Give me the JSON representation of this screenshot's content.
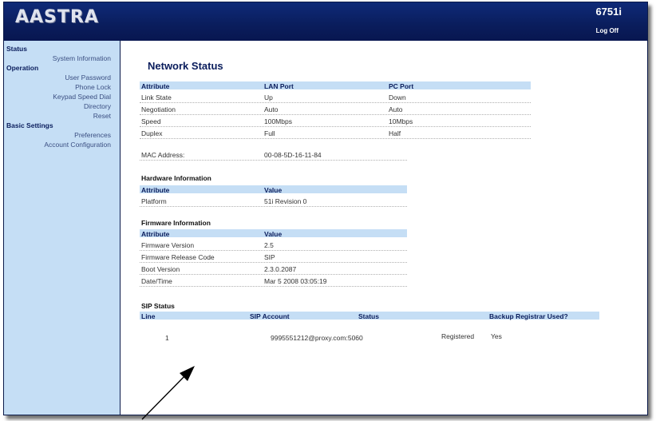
{
  "header": {
    "logo": "AASTRA",
    "model": "6751i",
    "logoff_label": "Log Off"
  },
  "sidebar": {
    "status_heading": "Status",
    "system_information": "System Information",
    "operation_heading": "Operation",
    "user_password": "User Password",
    "phone_lock": "Phone Lock",
    "keypad_speed_dial": "Keypad Speed Dial",
    "directory": "Directory",
    "reset": "Reset",
    "basic_settings_heading": "Basic Settings",
    "preferences": "Preferences",
    "account_configuration": "Account Configuration"
  },
  "main": {
    "title": "Network Status",
    "network": {
      "headers": [
        "Attribute",
        "LAN Port",
        "PC Port"
      ],
      "rows": [
        [
          "Link State",
          "Up",
          "Down"
        ],
        [
          "Negotiation",
          "Auto",
          "Auto"
        ],
        [
          "Speed",
          "100Mbps",
          "10Mbps"
        ],
        [
          "Duplex",
          "Full",
          "Half"
        ]
      ],
      "mac_label": "MAC Address:",
      "mac_value": "00-08-5D-16-11-84"
    },
    "hardware": {
      "title": "Hardware Information",
      "headers": [
        "Attribute",
        "Value"
      ],
      "rows": [
        [
          "Platform",
          "51i Revision 0"
        ]
      ]
    },
    "firmware": {
      "title": "Firmware Information",
      "headers": [
        "Attribute",
        "Value"
      ],
      "rows": [
        [
          "Firmware Version",
          "2.5"
        ],
        [
          "Firmware Release Code",
          "SIP"
        ],
        [
          "Boot Version",
          "2.3.0.2087"
        ],
        [
          "Date/Time",
          "Mar 5 2008 03:05:19"
        ]
      ]
    },
    "sip": {
      "title": "SIP Status",
      "headers": [
        "Line",
        "SIP Account",
        "Status",
        "Backup Registrar Used?"
      ],
      "rows": [
        [
          "1",
          "9995551212@proxy.com:5060",
          "Registered",
          "Yes"
        ]
      ]
    }
  },
  "colors": {
    "header_bg": "#0a1d5c",
    "sidebar_bg": "#c5def5",
    "table_header_bg": "#c5def5",
    "accent_text": "#0a1d5c"
  }
}
